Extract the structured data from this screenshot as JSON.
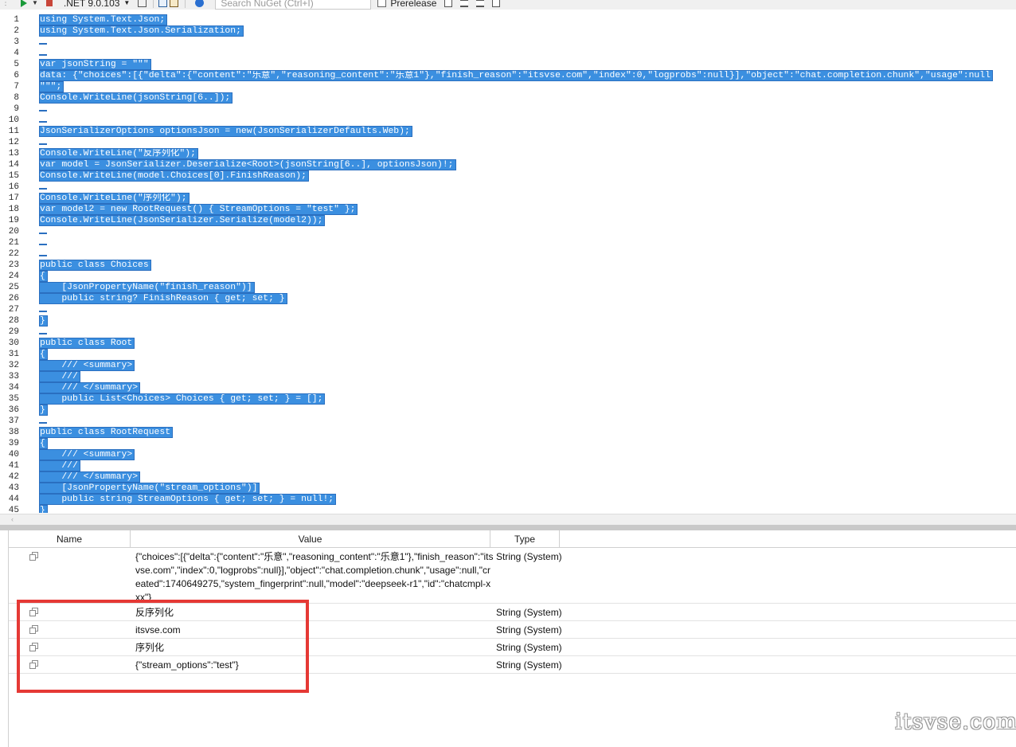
{
  "toolbar": {
    "framework": ".NET 9.0.103",
    "search_placeholder": "Search NuGet (Ctrl+I)",
    "prerelease_label": "Prerelease",
    "prerelease_checked": false
  },
  "editor": {
    "selection_color": "#3b8fe0",
    "lines": [
      {
        "n": "1",
        "text": "using System.Text.Json;"
      },
      {
        "n": "2",
        "text": "using System.Text.Json.Serialization;"
      },
      {
        "n": "3",
        "text": ""
      },
      {
        "n": "4",
        "text": ""
      },
      {
        "n": "5",
        "text": "var jsonString = \"\"\""
      },
      {
        "n": "6",
        "text": "data: {\"choices\":[{\"delta\":{\"content\":\"乐意\",\"reasoning_content\":\"乐意1\"},\"finish_reason\":\"itsvse.com\",\"index\":0,\"logprobs\":null}],\"object\":\"chat.completion.chunk\",\"usage\":null"
      },
      {
        "n": "7",
        "text": "\"\"\";"
      },
      {
        "n": "8",
        "text": "Console.WriteLine(jsonString[6..]);"
      },
      {
        "n": "9",
        "text": ""
      },
      {
        "n": "10",
        "text": ""
      },
      {
        "n": "11",
        "text": "JsonSerializerOptions optionsJson = new(JsonSerializerDefaults.Web);"
      },
      {
        "n": "12",
        "text": ""
      },
      {
        "n": "13",
        "text": "Console.WriteLine(\"反序列化\");"
      },
      {
        "n": "14",
        "text": "var model = JsonSerializer.Deserialize<Root>(jsonString[6..], optionsJson)!;"
      },
      {
        "n": "15",
        "text": "Console.WriteLine(model.Choices[0].FinishReason);"
      },
      {
        "n": "16",
        "text": ""
      },
      {
        "n": "17",
        "text": "Console.WriteLine(\"序列化\");"
      },
      {
        "n": "18",
        "text": "var model2 = new RootRequest() { StreamOptions = \"test\" };"
      },
      {
        "n": "19",
        "text": "Console.WriteLine(JsonSerializer.Serialize(model2));"
      },
      {
        "n": "20",
        "text": ""
      },
      {
        "n": "21",
        "text": ""
      },
      {
        "n": "22",
        "text": ""
      },
      {
        "n": "23",
        "text": "public class Choices"
      },
      {
        "n": "24",
        "text": "{"
      },
      {
        "n": "25",
        "text": "    [JsonPropertyName(\"finish_reason\")]"
      },
      {
        "n": "26",
        "text": "    public string? FinishReason { get; set; }"
      },
      {
        "n": "27",
        "text": ""
      },
      {
        "n": "28",
        "text": "}"
      },
      {
        "n": "29",
        "text": ""
      },
      {
        "n": "30",
        "text": "public class Root"
      },
      {
        "n": "31",
        "text": "{"
      },
      {
        "n": "32",
        "text": "    /// <summary>"
      },
      {
        "n": "33",
        "text": "    ///"
      },
      {
        "n": "34",
        "text": "    /// </summary>"
      },
      {
        "n": "35",
        "text": "    public List<Choices> Choices { get; set; } = [];"
      },
      {
        "n": "36",
        "text": "}"
      },
      {
        "n": "37",
        "text": ""
      },
      {
        "n": "38",
        "text": "public class RootRequest"
      },
      {
        "n": "39",
        "text": "{"
      },
      {
        "n": "40",
        "text": "    /// <summary>"
      },
      {
        "n": "41",
        "text": "    ///"
      },
      {
        "n": "42",
        "text": "    /// </summary>"
      },
      {
        "n": "43",
        "text": "    [JsonPropertyName(\"stream_options\")]"
      },
      {
        "n": "44",
        "text": "    public string StreamOptions { get; set; } = null!;"
      },
      {
        "n": "45",
        "text": "}"
      }
    ]
  },
  "results": {
    "columns": {
      "name": "Name",
      "value": "Value",
      "type": "Type"
    },
    "rows": [
      {
        "value": "{\"choices\":[{\"delta\":{\"content\":\"乐意\",\"reasoning_content\":\"乐意1\"},\"finish_reason\":\"itsvse.com\",\"index\":0,\"logprobs\":null}],\"object\":\"chat.completion.chunk\",\"usage\":null,\"created\":1740649275,\"system_fingerprint\":null,\"model\":\"deepseek-r1\",\"id\":\"chatcmpl-xxx\"}",
        "type": "String (System)"
      },
      {
        "value": "反序列化",
        "type": "String (System)"
      },
      {
        "value": "itsvse.com",
        "type": "String (System)"
      },
      {
        "value": "序列化",
        "type": "String (System)"
      },
      {
        "value": "{\"stream_options\":\"test\"}",
        "type": "String (System)"
      }
    ]
  },
  "annotation": {
    "color": "#e53935"
  },
  "watermark": "itsvse.com"
}
